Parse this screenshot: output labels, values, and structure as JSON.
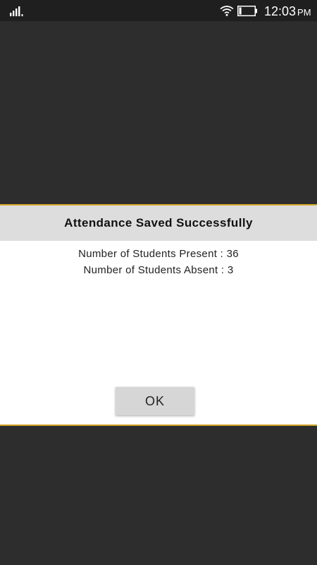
{
  "status_bar": {
    "time": "12:03",
    "ampm": "PM",
    "icons": [
      "signal-icon",
      "wifi-icon",
      "battery-icon"
    ],
    "battery_level": 0.15
  },
  "dialog": {
    "title": "Attendance Saved Successfully",
    "present_text": "Number of Students Present : 36",
    "absent_text": "Number of Students Absent : 3",
    "ok_label": "OK"
  },
  "colors": {
    "backdrop": "#2d2d2d",
    "status_bar": "#1f1f1f",
    "dialog_border": "#d4a62a",
    "title_band": "#dddddd",
    "button": "#d6d6d6"
  }
}
